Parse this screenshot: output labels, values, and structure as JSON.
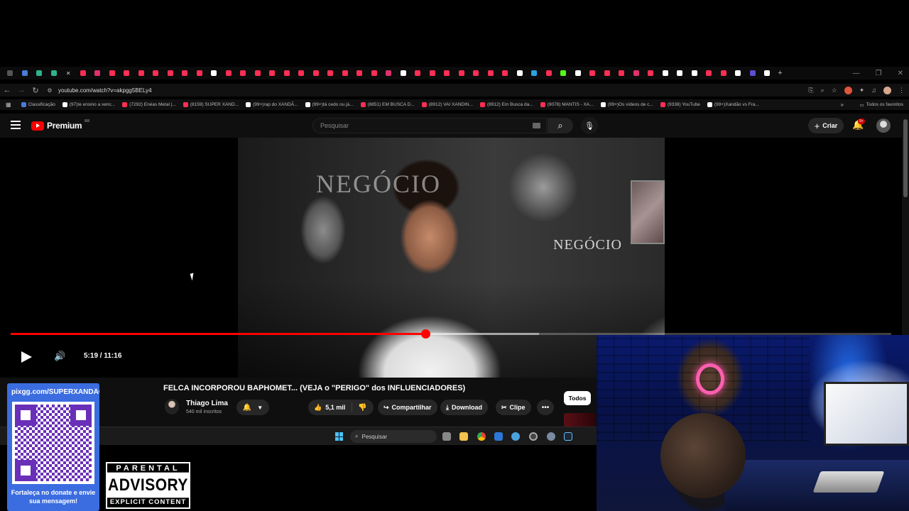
{
  "browser": {
    "url": "youtube.com/watch?v=akpgg5BELy4",
    "bookmarks": [
      "Classificação",
      "(97)Ie ensino a venc...",
      "(7292) Enéas Metal |...",
      "(8159) SUPER XAND...",
      "(99+)rap do XANDÃ...",
      "(99+)tá cedo ou já...",
      "(8851) EM BUSCA D...",
      "(8912) VAI XANDIN...",
      "(8912) Em Busca da...",
      "(9078) MANTIS - XA...",
      "(99+)Os vídeos de c...",
      "(9338) YouTube",
      "(99+)Xandão vs Fra..."
    ],
    "all_bookmarks": "Todos os favoritos"
  },
  "youtube": {
    "logo": "Premium",
    "country": "BR",
    "search_placeholder": "Pesquisar",
    "create_label": "Criar",
    "notifications_badge": "9+"
  },
  "player": {
    "video_watermark_1": "NEGÓCIO",
    "video_watermark_2": "NEGÓCIO",
    "time_display": "5:19 / 11:16",
    "progress": 0.471,
    "buffered": 0.6
  },
  "video": {
    "title": "FELCA INCORPOROU BAPHOMET... (VEJA o \"PERIGO\" dos INFLUENCIADORES)",
    "channel": "Thiago Lima",
    "subscribers": "540 mil inscritos",
    "likes": "5,1 mil",
    "share_label": "Compartilhar",
    "download_label": "Download",
    "clip_label": "Clipe",
    "filter_chip": "Todos"
  },
  "taskbar": {
    "search_placeholder": "Pesquisar"
  },
  "overlay": {
    "pix_url": "pixgg.com/SUPERXANDÃO",
    "pix_message": "Fortaleça no donate e envie sua mensagem!",
    "advisory_top": "PARENTAL",
    "advisory_mid": "ADVISORY",
    "advisory_bottom": "EXPLICIT CONTENT"
  },
  "colors": {
    "youtube_red": "#ff0000",
    "yt_background": "#0f0f0f",
    "pix_blue": "#3b6de0",
    "qr_purple": "#6a2fb8"
  }
}
